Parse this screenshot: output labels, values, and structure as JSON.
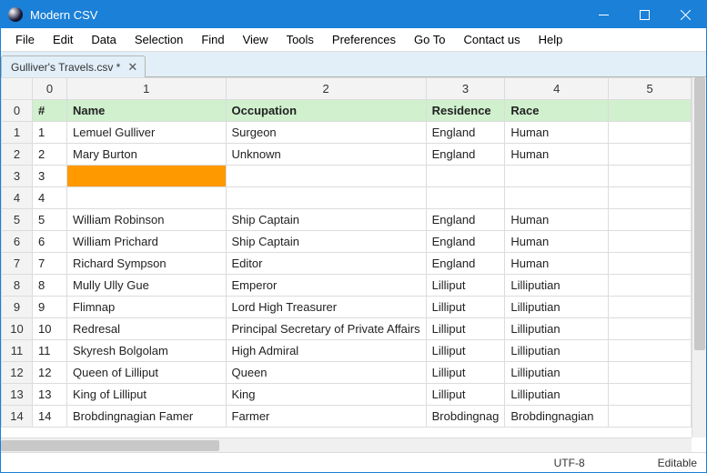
{
  "app": {
    "title": "Modern CSV"
  },
  "menubar": [
    "File",
    "Edit",
    "Data",
    "Selection",
    "Find",
    "View",
    "Tools",
    "Preferences",
    "Go To",
    "Contact us",
    "Help"
  ],
  "tab": {
    "label": "Gulliver's Travels.csv *"
  },
  "columns": {
    "headers": [
      "0",
      "1",
      "2",
      "3",
      "4",
      "5"
    ]
  },
  "header_row": {
    "idx": "0",
    "num": "#",
    "name": "Name",
    "occ": "Occupation",
    "res": "Residence",
    "race": "Race"
  },
  "rows": [
    {
      "idx": "1",
      "num": "1",
      "name": "Lemuel Gulliver",
      "occ": "Surgeon",
      "res": "England",
      "race": "Human"
    },
    {
      "idx": "2",
      "num": "2",
      "name": "Mary Burton",
      "occ": "Unknown",
      "res": "England",
      "race": "Human"
    },
    {
      "idx": "3",
      "num": "3",
      "name": "",
      "occ": "",
      "res": "",
      "race": ""
    },
    {
      "idx": "4",
      "num": "4",
      "name": "",
      "occ": "",
      "res": "",
      "race": ""
    },
    {
      "idx": "5",
      "num": "5",
      "name": "William Robinson",
      "occ": "Ship Captain",
      "res": "England",
      "race": "Human"
    },
    {
      "idx": "6",
      "num": "6",
      "name": "William Prichard",
      "occ": "Ship Captain",
      "res": "England",
      "race": "Human"
    },
    {
      "idx": "7",
      "num": "7",
      "name": "Richard Sympson",
      "occ": "Editor",
      "res": "England",
      "race": "Human"
    },
    {
      "idx": "8",
      "num": "8",
      "name": "Mully Ully Gue",
      "occ": "Emperor",
      "res": "Lilliput",
      "race": "Lilliputian"
    },
    {
      "idx": "9",
      "num": "9",
      "name": "Flimnap",
      "occ": "Lord High Treasurer",
      "res": "Lilliput",
      "race": "Lilliputian"
    },
    {
      "idx": "10",
      "num": "10",
      "name": "Redresal",
      "occ": "Principal Secretary of Private Affairs",
      "res": "Lilliput",
      "race": "Lilliputian"
    },
    {
      "idx": "11",
      "num": "11",
      "name": "Skyresh Bolgolam",
      "occ": "High Admiral",
      "res": "Lilliput",
      "race": "Lilliputian"
    },
    {
      "idx": "12",
      "num": "12",
      "name": "Queen of Lilliput",
      "occ": "Queen",
      "res": "Lilliput",
      "race": "Lilliputian"
    },
    {
      "idx": "13",
      "num": "13",
      "name": "King of Lilliput",
      "occ": "King",
      "res": "Lilliput",
      "race": "Lilliputian"
    },
    {
      "idx": "14",
      "num": "14",
      "name": "Brobdingnagian Famer",
      "occ": "Farmer",
      "res": "Brobdingnag",
      "race": "Brobdingnagian"
    }
  ],
  "highlight_row_index": 2,
  "status": {
    "encoding": "UTF-8",
    "mode": "Editable"
  }
}
